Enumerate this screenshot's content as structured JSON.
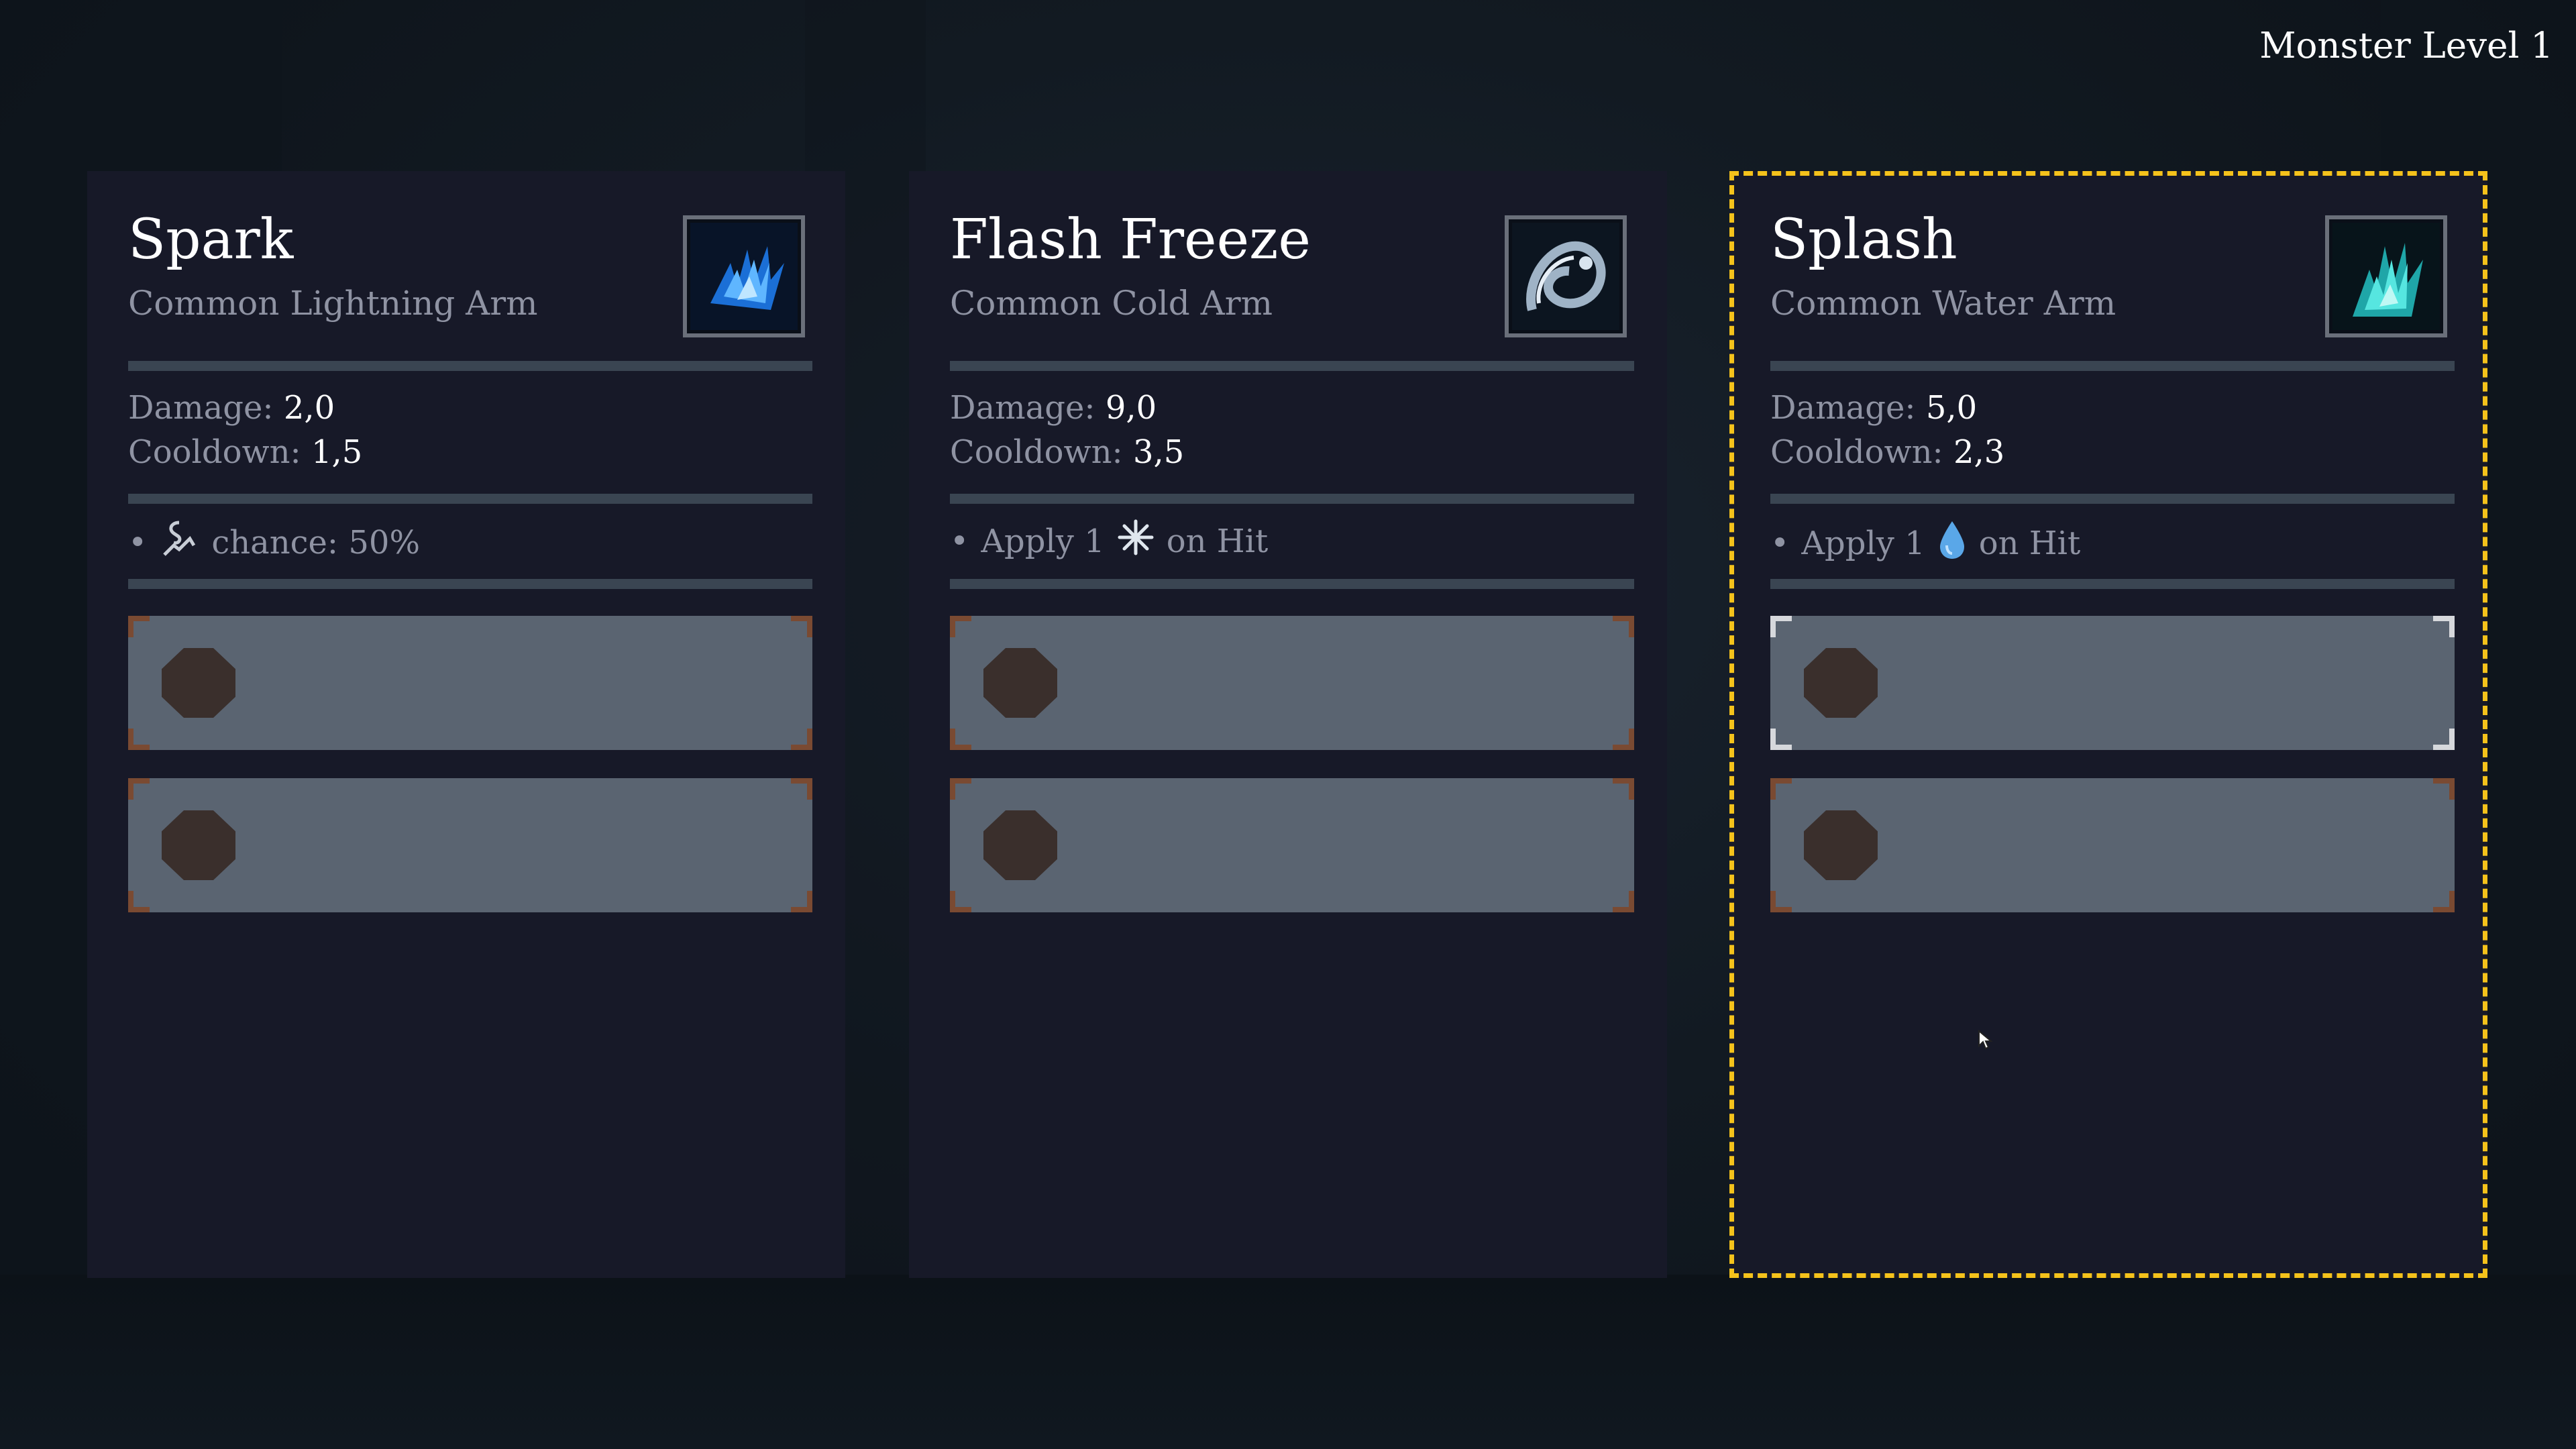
{
  "header": {
    "level_label": "Monster Level 1"
  },
  "cards": [
    {
      "title": "Spark",
      "subtitle": "Common Lightning Arm",
      "icon": "lightning-claw-icon",
      "damage_label": "Damage:",
      "damage_value": "2,0",
      "cooldown_label": "Cooldown:",
      "cooldown_value": "1,5",
      "effect_prefix": "",
      "effect_icon": "lightning-chain-icon",
      "effect_suffix": "chance: 50%",
      "selected": false
    },
    {
      "title": "Flash Freeze",
      "subtitle": "Common Cold Arm",
      "icon": "frost-claw-icon",
      "damage_label": "Damage:",
      "damage_value": "9,0",
      "cooldown_label": "Cooldown:",
      "cooldown_value": "3,5",
      "effect_prefix": "Apply 1",
      "effect_icon": "snowflake-icon",
      "effect_suffix": "on Hit",
      "selected": false
    },
    {
      "title": "Splash",
      "subtitle": "Common Water Arm",
      "icon": "water-claw-icon",
      "damage_label": "Damage:",
      "damage_value": "5,0",
      "cooldown_label": "Cooldown:",
      "cooldown_value": "2,3",
      "effect_prefix": "Apply 1",
      "effect_icon": "water-drop-icon",
      "effect_suffix": "on Hit",
      "selected": true
    }
  ],
  "colors": {
    "selection": "#f5c21b",
    "card_bg": "#171928",
    "slot_bg": "#5a6471",
    "socket": "#3a2f2c"
  }
}
